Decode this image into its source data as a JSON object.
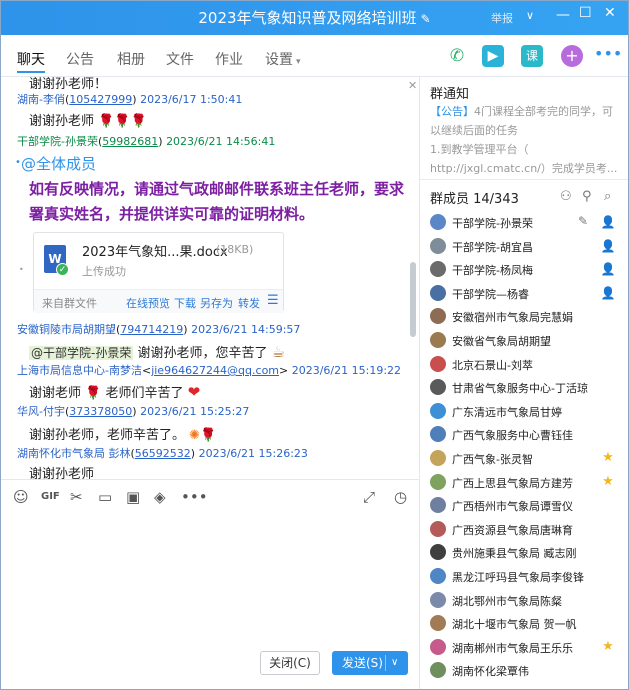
{
  "window": {
    "title": "2023年气象知识普及网络培训班",
    "report": "举报"
  },
  "tabs": [
    {
      "label": "聊天"
    },
    {
      "label": "公告"
    },
    {
      "label": "相册"
    },
    {
      "label": "文件"
    },
    {
      "label": "作业"
    },
    {
      "label": "设置"
    }
  ],
  "toolbar_icons": [
    "phone-icon",
    "video-icon",
    "class-icon",
    "add-app-icon",
    "more-icon"
  ],
  "messages": [
    {
      "text": "谢谢孙老师！"
    },
    {
      "name": "湖南-李俏",
      "id": "105427999",
      "time": "2023/6/17 1:50:41",
      "body": "谢谢孙老师"
    },
    {
      "name": "干部学院-孙景荣",
      "id": "59982681",
      "time": "2023/6/21 14:56:41"
    },
    {
      "at_all": "@全体成员",
      "notice": "如有反映情况，请通过气政邮邮件联系班主任老师，要求署真实姓名，并提供详实可靠的证明材料。"
    },
    {
      "name": "安徽铜陵市局胡期望",
      "id": "794714219",
      "time": "2023/6/21 14:59:57",
      "mention": "@干部学院-孙景荣",
      "body": "谢谢孙老师，您辛苦了"
    },
    {
      "name": "上海市局信息中心-南梦洁",
      "id": "jie964627244@qq.com",
      "time": "2023/6/21 15:19:22",
      "body": "谢谢老师",
      "body2": "老师们辛苦了"
    },
    {
      "name": "华风-付宇",
      "id": "373378050",
      "time": "2023/6/21 15:25:27",
      "body": "谢谢孙老师，老师辛苦了。"
    },
    {
      "name": "湖南怀化市气象局 彭林",
      "id": "56592532",
      "time": "2023/6/21 15:26:23",
      "body": "谢谢孙老师"
    }
  ],
  "file": {
    "name": "2023年气象知...果.docx",
    "size": "(18KB)",
    "status": "上传成功",
    "source": "来自群文件",
    "actions": [
      "在线预览",
      "下载",
      "另存为",
      "转发"
    ]
  },
  "buttons": {
    "close": "关闭(C)",
    "send": "发送(S)"
  },
  "side": {
    "notice_title": "群通知",
    "notice_tag": "【公告】",
    "notice_text": "4门课程全部考完的同学，可以继续后面的任务",
    "notice_line2": "1.到教学管理平台（",
    "notice_line3": "http://jxgl.cmatc.cn/）完成学员考...",
    "members_title": "群成员 14/343",
    "members": [
      {
        "name": "干部学院-孙景荣",
        "color": "#5b87c9",
        "badge": "admin"
      },
      {
        "name": "干部学院-胡宜昌",
        "color": "#7d8d99",
        "badge": "admin"
      },
      {
        "name": "干部学院-杨凤梅",
        "color": "#6b6b6b",
        "badge": "admin"
      },
      {
        "name": "干部学院—杨睿",
        "color": "#4a6fa5",
        "badge": "admin"
      },
      {
        "name": "安徽宿州市气象局完慧娟",
        "color": "#8e6b53",
        "badge": ""
      },
      {
        "name": "安徽省气象局胡期望",
        "color": "#9a7a4f",
        "badge": ""
      },
      {
        "name": "北京石景山-刘萃",
        "color": "#c94f4f",
        "badge": ""
      },
      {
        "name": "甘肃省气象服务中心-丁活琼",
        "color": "#5a5a5a",
        "badge": ""
      },
      {
        "name": "广东清远市气象局甘婷",
        "color": "#3d8fd6",
        "badge": ""
      },
      {
        "name": "广西气象服务中心曹钰佳",
        "color": "#4f7fb8",
        "badge": ""
      },
      {
        "name": "广西气象-张灵智",
        "color": "#c4a35a",
        "badge": "star"
      },
      {
        "name": "广西上思县气象局方建芳",
        "color": "#7fa35f",
        "badge": "star"
      },
      {
        "name": "广西梧州市气象局谭雪仪",
        "color": "#6f7fa0",
        "badge": ""
      },
      {
        "name": "广西资源县气象局唐琳育",
        "color": "#b55a5a",
        "badge": ""
      },
      {
        "name": "贵州施秉县气象局 臧志刚",
        "color": "#3f3f3f",
        "badge": ""
      },
      {
        "name": "黑龙江呼玛县气象局李俊锋",
        "color": "#4f86c6",
        "badge": ""
      },
      {
        "name": "湖北鄂州市气象局陈粲",
        "color": "#7a8aa8",
        "badge": ""
      },
      {
        "name": "湖北十堰市气象局 贺一帆",
        "color": "#a07b55",
        "badge": ""
      },
      {
        "name": "湖南郴州市气象局王乐乐",
        "color": "#c65a8a",
        "badge": "star"
      },
      {
        "name": "湖南怀化梁覃伟",
        "color": "#6f8f5f",
        "badge": ""
      }
    ]
  }
}
